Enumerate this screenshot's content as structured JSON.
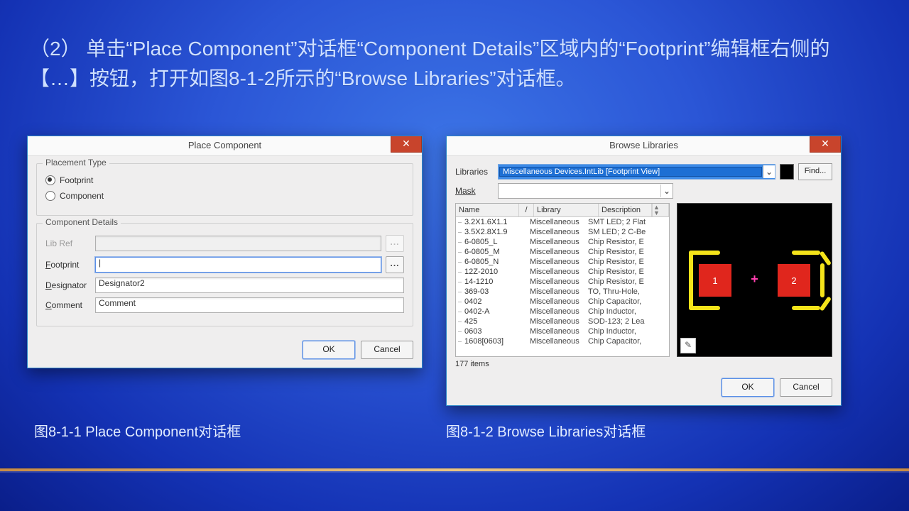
{
  "instruction": "（2） 单击“Place Component”对话框“Component Details”区域内的“Footprint”编辑框右侧的【…】按钮，打开如图8-1-2所示的“Browse Libraries”对话框。",
  "dlg1": {
    "title": "Place Component",
    "close": "✕",
    "placement_legend": "Placement Type",
    "radio_footprint": "Footprint",
    "radio_component": "Component",
    "details_legend": "Component Details",
    "libref_label": "Lib Ref",
    "footprint_label": "Footprint",
    "designator_label": "Designator",
    "designator_value": "Designator2",
    "comment_label": "Comment",
    "comment_value": "Comment",
    "dots": "...",
    "ok": "OK",
    "cancel": "Cancel"
  },
  "dlg2": {
    "title": "Browse Libraries",
    "close": "✕",
    "libraries_label": "Libraries",
    "library_selected": "Miscellaneous Devices.IntLib [Footprint View]",
    "find": "Find...",
    "mask_label": "Mask",
    "headers": {
      "name": "Name",
      "sort": "/",
      "library": "Library",
      "description": "Description",
      "scroll": "▲"
    },
    "rows": [
      {
        "n": "3.2X1.6X1.1",
        "l": "Miscellaneous",
        "d": "SMT LED; 2 Flat"
      },
      {
        "n": "3.5X2.8X1.9",
        "l": "Miscellaneous",
        "d": "SM LED; 2 C-Be"
      },
      {
        "n": "6-0805_L",
        "l": "Miscellaneous",
        "d": "Chip Resistor, E"
      },
      {
        "n": "6-0805_M",
        "l": "Miscellaneous",
        "d": "Chip Resistor, E"
      },
      {
        "n": "6-0805_N",
        "l": "Miscellaneous",
        "d": "Chip Resistor, E"
      },
      {
        "n": "12Z-2010",
        "l": "Miscellaneous",
        "d": "Chip Resistor, E"
      },
      {
        "n": "14-1210",
        "l": "Miscellaneous",
        "d": "Chip Resistor, E"
      },
      {
        "n": "369-03",
        "l": "Miscellaneous",
        "d": "TO, Thru-Hole,"
      },
      {
        "n": "0402",
        "l": "Miscellaneous",
        "d": "Chip Capacitor,"
      },
      {
        "n": "0402-A",
        "l": "Miscellaneous",
        "d": "Chip Inductor,"
      },
      {
        "n": "425",
        "l": "Miscellaneous",
        "d": "SOD-123; 2 Lea"
      },
      {
        "n": "0603",
        "l": "Miscellaneous",
        "d": "Chip Inductor,"
      },
      {
        "n": "1608[0603]",
        "l": "Miscellaneous",
        "d": "Chip Capacitor,"
      }
    ],
    "count": "177 items",
    "pad1": "1",
    "pad2": "2",
    "plus": "+",
    "tool": "✎",
    "ok": "OK",
    "cancel": "Cancel"
  },
  "caption1": "图8-1-1  Place Component对话框",
  "caption2": "图8-1-2  Browse Libraries对话框"
}
